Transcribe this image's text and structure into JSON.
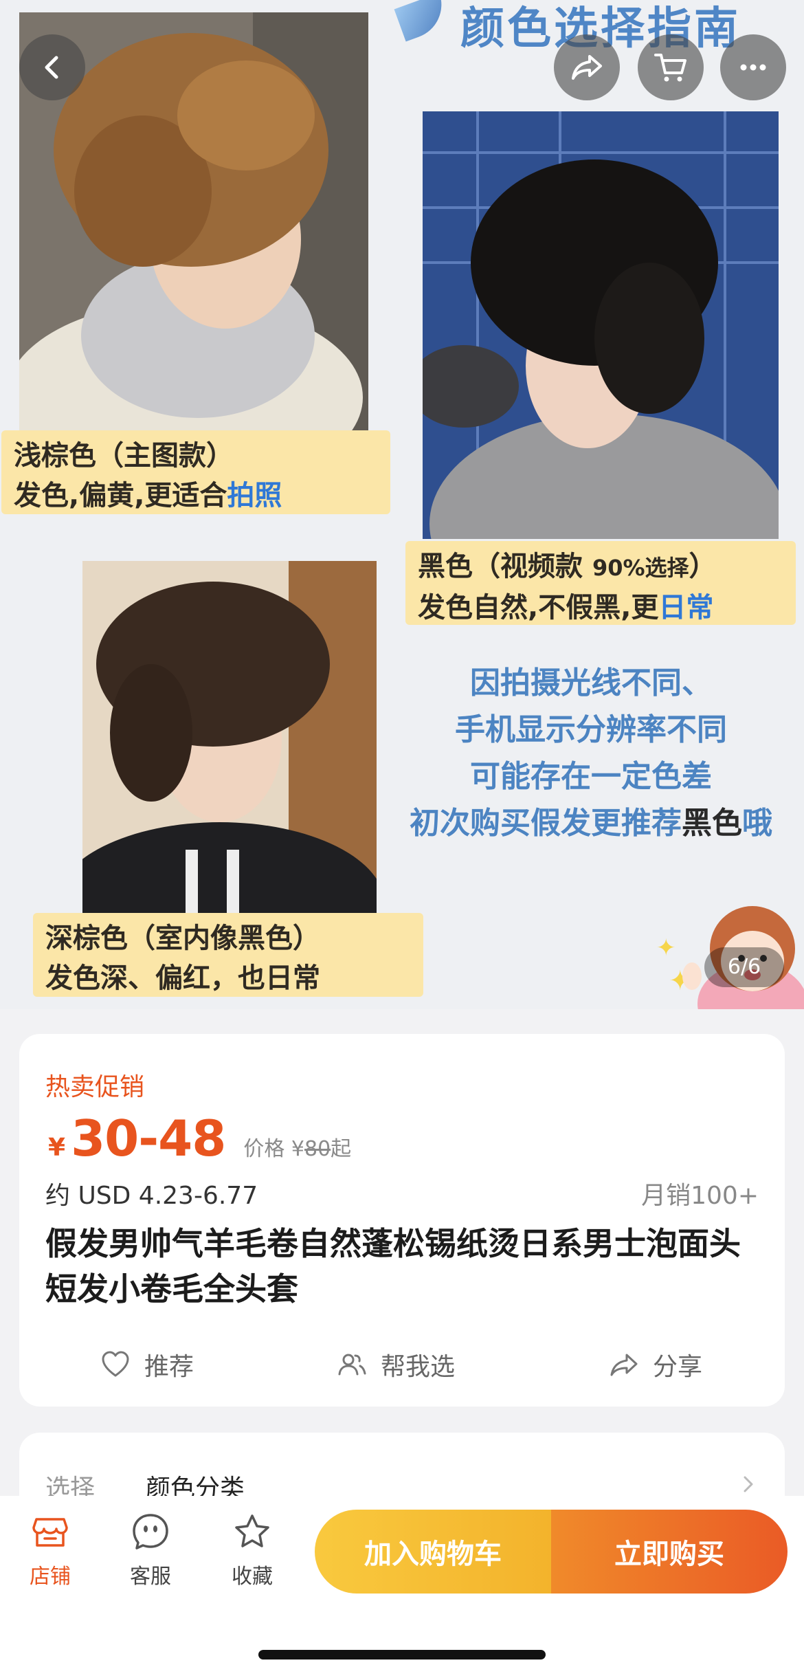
{
  "gallery": {
    "banner_title": "颜色选择指南",
    "captions": {
      "light_brown": {
        "line1": "浅棕色（主图款）",
        "line2_prefix": "发色,偏黄,更适合",
        "line2_highlight": "拍照"
      },
      "black": {
        "line1_prefix": "黑色（视频款 ",
        "line1_small": "90%选择",
        "line1_suffix": "）",
        "line2_prefix": "发色自然,不假黑,更",
        "line2_highlight": "日常"
      },
      "dark_brown": {
        "line1": "深棕色（室内像黑色）",
        "line2": "发色深、偏红，也日常"
      }
    },
    "note": {
      "line1": "因拍摄光线不同、",
      "line2": "手机显示分辨率不同",
      "line3": "可能存在一定色差",
      "line4_prefix": "初次购买假发更推荐",
      "line4_emph": "黑色",
      "line4_suffix": "哦"
    },
    "counter": "6/6"
  },
  "top_buttons": {
    "back": "back-arrow-icon",
    "share": "share-icon",
    "cart": "cart-icon",
    "more": "more-dots-icon"
  },
  "product": {
    "promo_label": "热卖促销",
    "currency_symbol": "¥",
    "price_range": "30-48",
    "original_price_label": "价格",
    "original_price_symbol": "¥",
    "original_price": "80",
    "original_price_suffix": "起",
    "usd_range": "约 USD 4.23-6.77",
    "monthly_sales": "月销100+",
    "title": "假发男帅气羊毛卷自然蓬松锡纸烫日系男士泡面头短发小卷毛全头套",
    "actions": {
      "recommend": "推荐",
      "help_me_choose": "帮我选",
      "share": "分享"
    }
  },
  "options": {
    "label": "选择",
    "value": "颜色分类"
  },
  "bottom_bar": {
    "store": "店铺",
    "service": "客服",
    "favorite": "收藏",
    "add_to_cart": "加入购物车",
    "buy_now": "立即购买"
  },
  "colors": {
    "accent_orange": "#e8541e",
    "cart_button": "#f6bf36",
    "buy_button": "#ec6a27",
    "caption_bg": "#fbe6a8",
    "note_blue": "#4c84c2"
  }
}
